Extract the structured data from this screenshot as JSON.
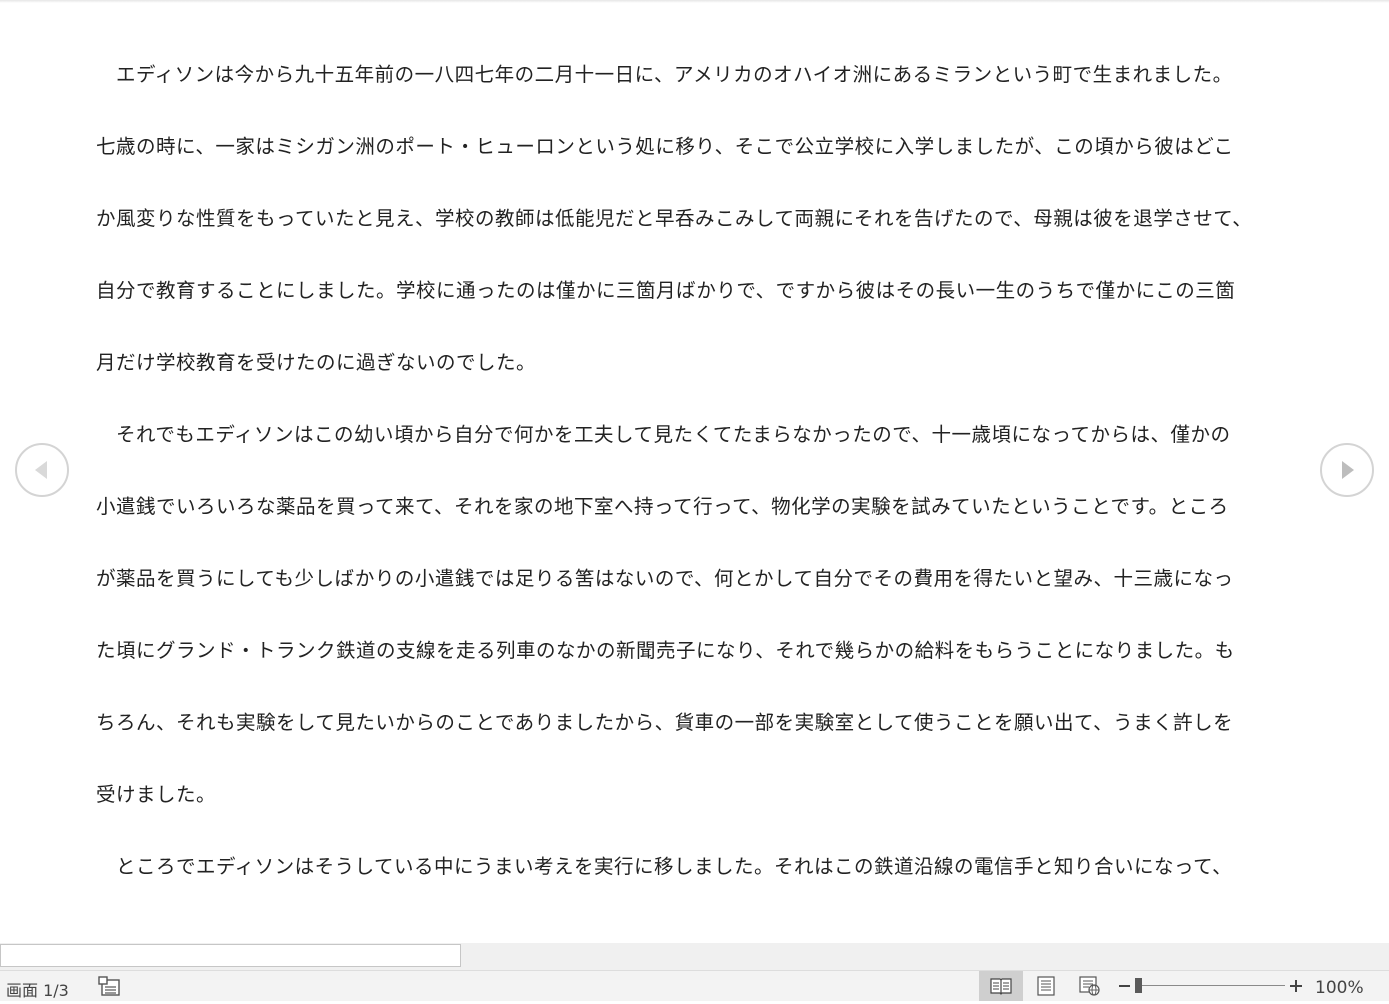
{
  "document": {
    "lines": [
      "　エディソンは今から九十五年前の一八四七年の二月十一日に、アメリカのオハイオ洲にあるミランという町で生まれました。",
      "七歳の時に、一家はミシガン洲のポート・ヒューロンという処に移り、そこで公立学校に入学しましたが、この頃から彼はどこ",
      "か風変りな性質をもっていたと見え、学校の教師は低能児だと早呑みこみして両親にそれを告げたので、母親は彼を退学させて、",
      "自分で教育することにしました。学校に通ったのは僅かに三箇月ばかりで、ですから彼はその長い一生のうちで僅かにこの三箇",
      "月だけ学校教育を受けたのに過ぎないのでした。",
      "　それでもエディソンはこの幼い頃から自分で何かを工夫して見たくてたまらなかったので、十一歳頃になってからは、僅かの",
      "小遣銭でいろいろな薬品を買って来て、それを家の地下室へ持って行って、物化学の実験を試みていたということです。ところ",
      "が薬品を買うにしても少しばかりの小遣銭では足りる筈はないので、何とかして自分でその費用を得たいと望み、十三歳になっ",
      "た頃にグランド・トランク鉄道の支線を走る列車のなかの新聞売子になり、それで幾らかの給料をもらうことになりました。も",
      "ちろん、それも実験をして見たいからのことでありましたから、貨車の一部を実験室として使うことを願い出て、うまく許しを",
      "受けました。",
      "　ところでエディソンはそうしている中にうまい考えを実行に移しました。それはこの鉄道沿線の電信手と知り合いになって、"
    ]
  },
  "nav": {
    "prev_icon": "triangle-left-icon",
    "next_icon": "triangle-right-icon"
  },
  "statusbar": {
    "page_indicator": "画面 1/3",
    "track_changes_icon": "document-list-icon",
    "views": [
      "read-mode-icon",
      "print-layout-icon",
      "web-layout-icon"
    ],
    "zoom": {
      "minus": "−",
      "plus": "+",
      "level": "100%",
      "slider_fraction": 0.0
    }
  },
  "colors": {
    "text": "#222222",
    "statusbar_bg": "#f3f3f3",
    "active_view_bg": "#cfcfcf",
    "nav_ring": "#d4d4d4"
  }
}
